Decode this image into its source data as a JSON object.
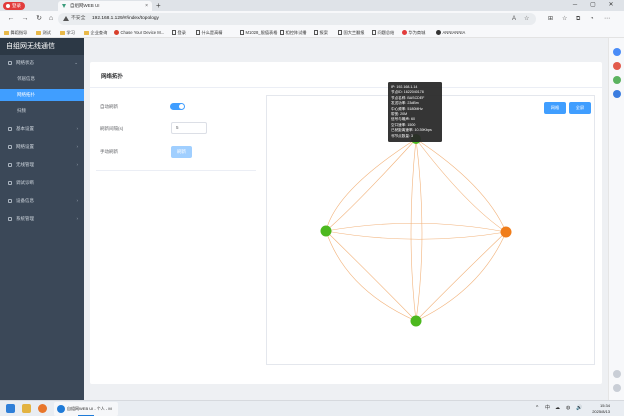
{
  "browser": {
    "profile_label": "登录",
    "tab_title": "自组网WEB UI",
    "tab_close": "×",
    "new_tab": "+",
    "window_controls": [
      "─",
      "▢",
      "✕"
    ],
    "nav": {
      "back": "←",
      "forward": "→",
      "reload": "↻",
      "home": "⌂"
    },
    "security_label": "不安全",
    "url": "192.168.1.129/#/index/topology",
    "omnibox_icons": [
      "A",
      "☆"
    ],
    "toolbar_icons": [
      "⊞",
      "☆",
      "⧉",
      "◔",
      "⋯"
    ]
  },
  "bookmarks": [
    {
      "label": "舞蹈指导",
      "icon": "folder"
    },
    {
      "label": "测试",
      "icon": "folder"
    },
    {
      "label": "学习",
      "icon": "folder"
    },
    {
      "label": "企业查询",
      "icon": "folder"
    },
    {
      "label": "Chase Your Device M...",
      "icon": "red-circle"
    },
    {
      "label": "登录",
      "icon": "grid"
    },
    {
      "label": "什么是高精",
      "icon": "page"
    },
    {
      "label": "M1028_限值表格",
      "icon": "page"
    },
    {
      "label": "相控阵试播",
      "icon": "page"
    },
    {
      "label": "报案",
      "icon": "page"
    },
    {
      "label": "国大兰翻报",
      "icon": "page"
    },
    {
      "label": "问题总结",
      "icon": "page"
    },
    {
      "label": "华为商城",
      "icon": "red-circle"
    },
    {
      "label": "ANNIANNIA",
      "icon": "dark-circle"
    }
  ],
  "sidebar": {
    "brand": "自组网无线通信",
    "items": [
      {
        "label": "网络状态",
        "chevron": "⌄",
        "type": "group"
      },
      {
        "label": "邻居信息",
        "type": "sub"
      },
      {
        "label": "网络拓扑",
        "type": "sub",
        "active": true
      },
      {
        "label": "扫频",
        "type": "sub"
      },
      {
        "label": "基本设置",
        "chevron": "›",
        "type": "group"
      },
      {
        "label": "网络设置",
        "chevron": "›",
        "type": "group"
      },
      {
        "label": "无线管理",
        "chevron": "›",
        "type": "group"
      },
      {
        "label": "调试诊断",
        "type": "group"
      },
      {
        "label": "设备信息",
        "chevron": "›",
        "type": "group"
      },
      {
        "label": "系统管理",
        "chevron": "›",
        "type": "group"
      }
    ]
  },
  "page": {
    "title": "网络拓扑",
    "auto_refresh_label": "自动刷新",
    "auto_refresh_on": true,
    "interval_label": "刷新间隔(s)",
    "interval_value": "5",
    "manual_refresh_label": "手动刷新",
    "refresh_button": "刷新",
    "topology_buttons": [
      "网格",
      "全屏"
    ]
  },
  "topology": {
    "nodes": [
      {
        "id": "top",
        "color": "#4cb81e"
      },
      {
        "id": "left",
        "color": "#4cb81e"
      },
      {
        "id": "right",
        "color": "#f07d1a"
      },
      {
        "id": "bottom",
        "color": "#4cb81e"
      }
    ],
    "link_color": "#f2b27a"
  },
  "tooltip": {
    "rows": [
      "IP: 192.168.1.14",
      "节点ID: 1622040178",
      "节点名称: BASCDEF",
      "发送功率: 23dBm",
      "中心频率: 5180MHz",
      "带宽: 20M",
      "信号与噪声: 60",
      "空口速率: 1500",
      "已驶距离速率: 10.39Kbps",
      "邻节点数量: 3"
    ]
  },
  "taskbar": {
    "active_window": "自组网WEB UI - 个人 - M",
    "tray": [
      "^",
      "中",
      "☁",
      "◍",
      "🔊"
    ],
    "time": "15:34",
    "date": "2025/8/13"
  },
  "colors": {
    "accent": "#409eff",
    "sidebar_bg": "#3b4858",
    "brand_bg": "#2c3845"
  }
}
